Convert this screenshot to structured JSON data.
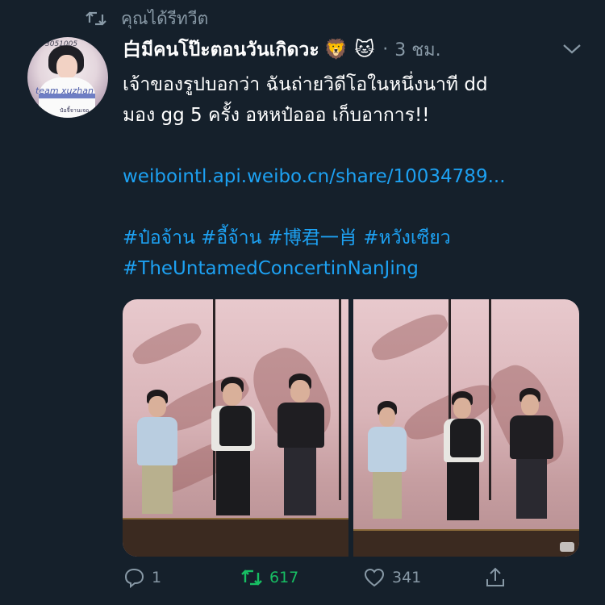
{
  "retweet_context": {
    "text": "คุณได้รีทวีต"
  },
  "tweet": {
    "display_name": "白มีคนโป๊ะตอนวันเกิดวะ",
    "emoji": "🦁 🐱",
    "separator": "·",
    "timestamp": "3 ชม.",
    "text_lines": [
      "เจ้าของรูปบอกว่า ฉันถ่ายวิดีโอในหนึ่งนาที dd",
      "มอง gg 5 ครั้ง อหหป๋อออ เก็บอาการ!!"
    ],
    "link": "weibointl.api.weibo.cn/share/10034789...",
    "hashtags_line1": [
      "#ป๋อจ้าน",
      "#อี้จ้าน",
      "#博君一肖",
      "#หวังเซียว"
    ],
    "hashtags_line2": [
      "#TheUntamedConcertinNanJing"
    ]
  },
  "avatar": {
    "text_top": "3051005",
    "text_mid": "team xuzhan",
    "text_bottom": "ป๋อจี้จานเจอ"
  },
  "actions": {
    "reply_count": "1",
    "retweet_count": "617",
    "like_count": "341"
  },
  "colors": {
    "background": "#15202b",
    "secondary_text": "#8899a6",
    "link": "#1da1f2",
    "retweet_active": "#17bf63"
  },
  "icons": [
    "retweet-icon",
    "chevron-down-icon",
    "reply-icon",
    "retweet-icon",
    "like-icon",
    "share-icon"
  ]
}
